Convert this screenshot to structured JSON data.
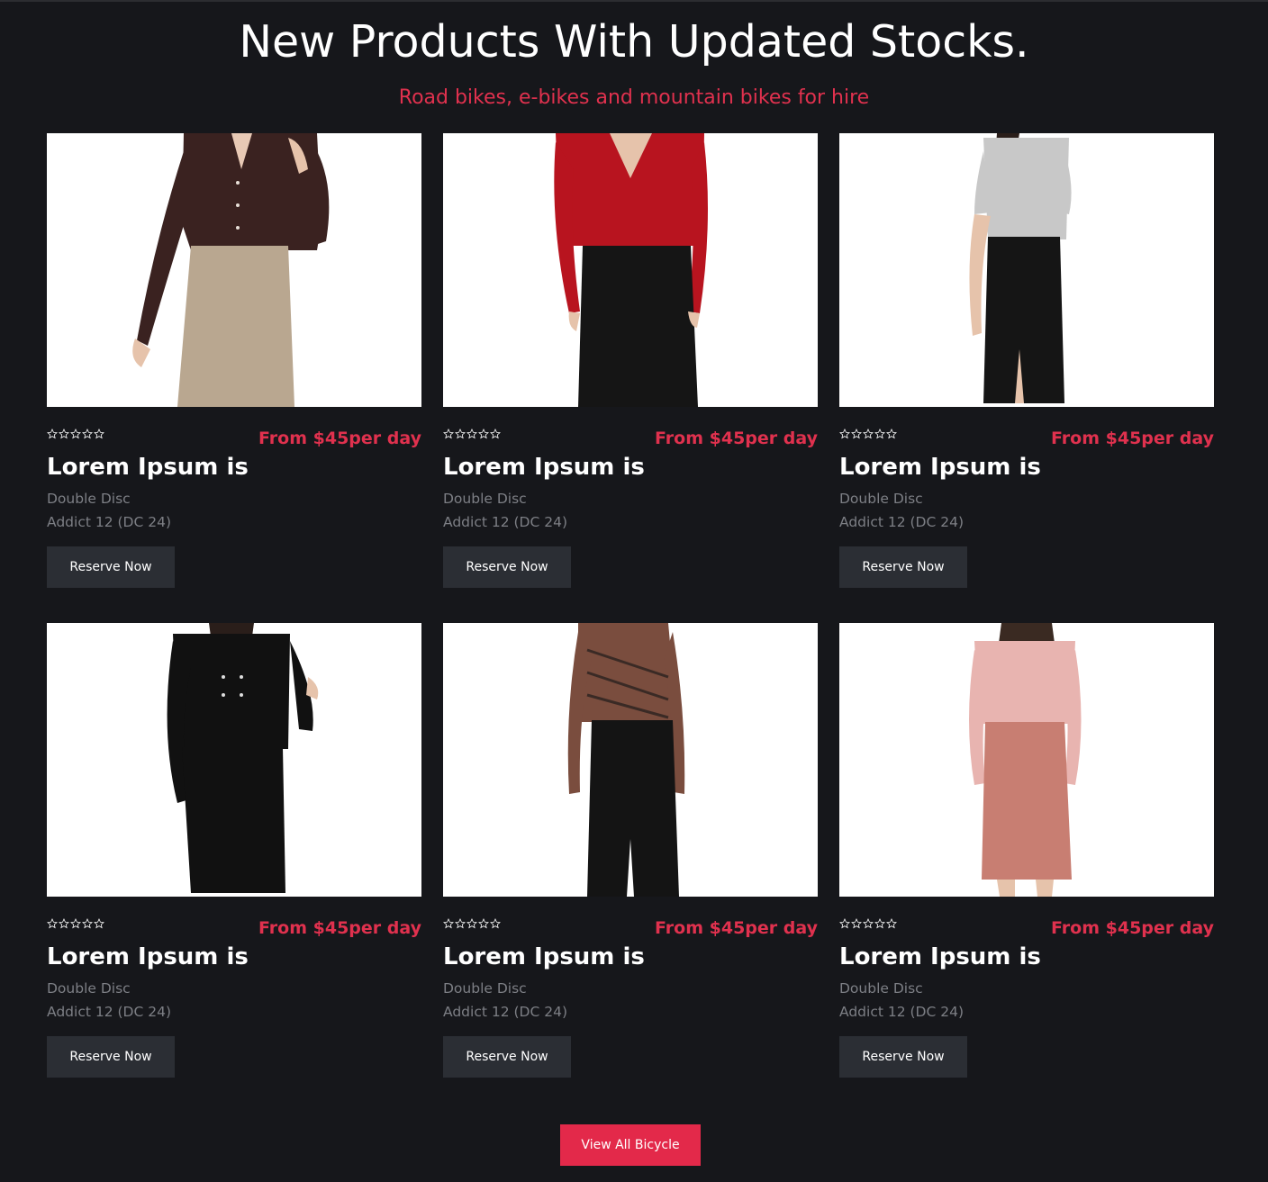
{
  "header": {
    "title": "New Products With Updated Stocks.",
    "subtitle": "Road bikes, e-bikes and mountain bikes for hire"
  },
  "colors": {
    "accent": "#e3294a",
    "background": "#16171b",
    "button": "#2b2e34",
    "muted_text": "#7d7f85"
  },
  "products": [
    {
      "image": "woman-brown-blouse-tan-skirt-photo",
      "rating": 0,
      "rating_max": 5,
      "price": "From $45per day",
      "title": "Lorem Ipsum is",
      "spec_line1": "Double Disc",
      "spec_line2": "Addict 12 (DC 24)",
      "button": "Reserve Now"
    },
    {
      "image": "woman-red-blouse-black-skirt-photo",
      "rating": 0,
      "rating_max": 5,
      "price": "From $45per day",
      "title": "Lorem Ipsum is",
      "spec_line1": "Double Disc",
      "spec_line2": "Addict 12 (DC 24)",
      "button": "Reserve Now"
    },
    {
      "image": "woman-grey-top-black-skirt-photo",
      "rating": 0,
      "rating_max": 5,
      "price": "From $45per day",
      "title": "Lorem Ipsum is",
      "spec_line1": "Double Disc",
      "spec_line2": "Addict 12 (DC 24)",
      "button": "Reserve Now"
    },
    {
      "image": "woman-black-dress-photo",
      "rating": 0,
      "rating_max": 5,
      "price": "From $45per day",
      "title": "Lorem Ipsum is",
      "spec_line1": "Double Disc",
      "spec_line2": "Addict 12 (DC 24)",
      "button": "Reserve Now"
    },
    {
      "image": "woman-striped-blouse-black-skirt-photo",
      "rating": 0,
      "rating_max": 5,
      "price": "From $45per day",
      "title": "Lorem Ipsum is",
      "spec_line1": "Double Disc",
      "spec_line2": "Addict 12 (DC 24)",
      "button": "Reserve Now"
    },
    {
      "image": "woman-pink-blouse-rose-skirt-photo",
      "rating": 0,
      "rating_max": 5,
      "price": "From $45per day",
      "title": "Lorem Ipsum is",
      "spec_line1": "Double Disc",
      "spec_line2": "Addict 12 (DC 24)",
      "button": "Reserve Now"
    }
  ],
  "footer": {
    "view_all_label": "View All Bicycle"
  }
}
